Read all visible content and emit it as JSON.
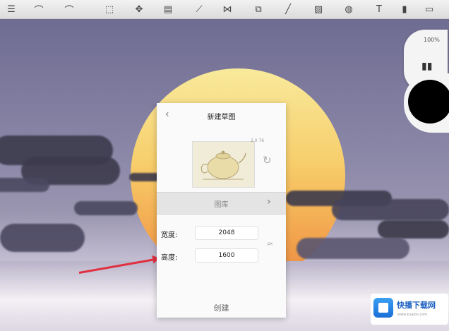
{
  "toolbar": {
    "tools": [
      {
        "icon": "menu-icon"
      },
      {
        "icon": "undo-icon"
      },
      {
        "icon": "redo-icon"
      },
      {
        "icon": "selection-icon"
      },
      {
        "icon": "move-icon"
      },
      {
        "icon": "layers-icon"
      },
      {
        "icon": "ruler-icon"
      },
      {
        "icon": "symmetry-icon"
      },
      {
        "icon": "copy-icon"
      },
      {
        "icon": "pen-icon"
      },
      {
        "icon": "image-icon"
      },
      {
        "icon": "fill-icon"
      },
      {
        "icon": "text-icon"
      },
      {
        "icon": "book-icon"
      },
      {
        "icon": "window-icon"
      }
    ]
  },
  "side_panel": {
    "ratio": "100%"
  },
  "dialog": {
    "title": "新建草图",
    "back_label": "‹",
    "dim_hint": "2,0 76",
    "gallery_label": "图库",
    "gallery_chevron": "›",
    "width_label": "宽度:",
    "width_value": "2048",
    "height_label": "高度:",
    "height_value": "1600",
    "unit": "px",
    "create_label": "创建"
  },
  "watermark": {
    "name": "快播下载网",
    "url": "www.kuaibo.com"
  },
  "colors": {
    "accent": "#e03040",
    "brand": "#1a6fd8"
  }
}
